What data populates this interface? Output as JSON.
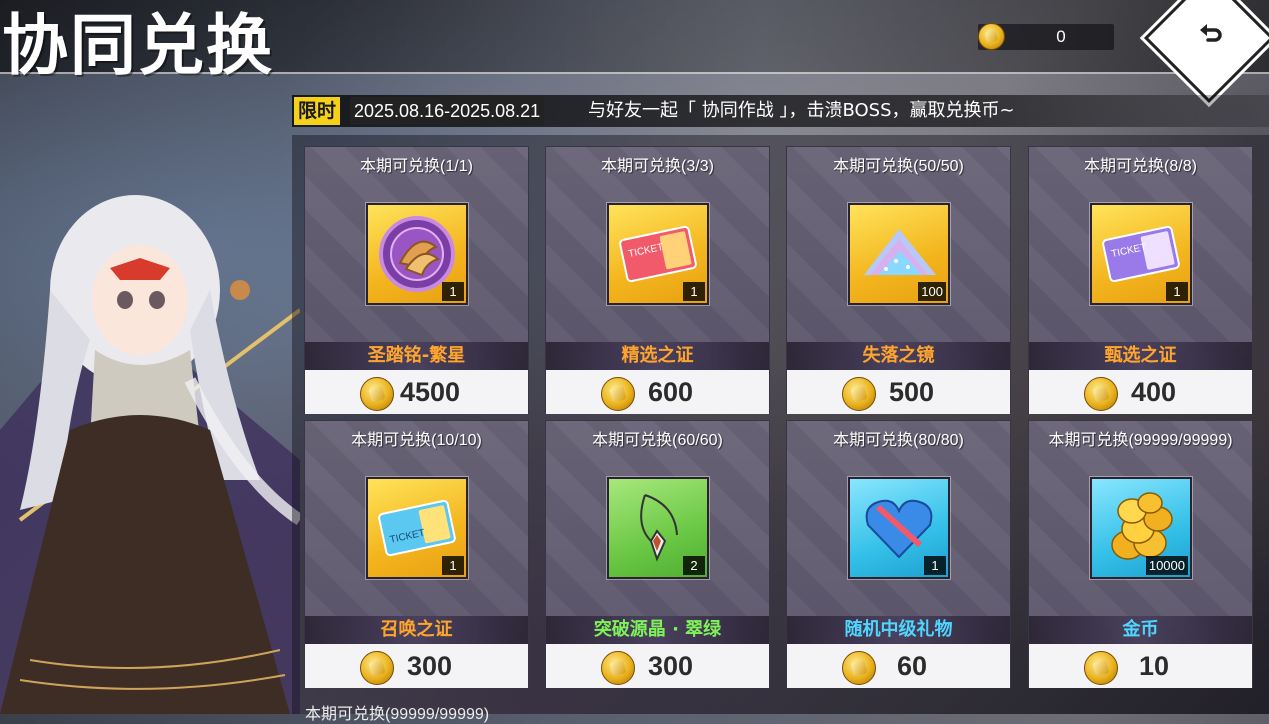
{
  "header": {
    "title": "协同兑换",
    "currency_value": "0",
    "back_icon": "undo-arrow-icon"
  },
  "banner": {
    "tag": "限时",
    "dates": "2025.08.16-2025.08.21",
    "description": "与好友一起「 协同作战 」，击溃BOSS，赢取兑换币~"
  },
  "items": [
    {
      "limit": "本期可兑换(1/1)",
      "name": "圣踏铭-繁星",
      "qty": "1",
      "price": "4500",
      "frame": "gold",
      "name_color": "orange",
      "icon": "star-emblem-icon"
    },
    {
      "limit": "本期可兑换(3/3)",
      "name": "精选之证",
      "qty": "1",
      "price": "600",
      "frame": "gold",
      "name_color": "orange",
      "icon": "ticket-icon"
    },
    {
      "limit": "本期可兑换(50/50)",
      "name": "失落之镜",
      "qty": "100",
      "price": "500",
      "frame": "gold",
      "name_color": "orange",
      "icon": "crystal-dust-icon"
    },
    {
      "limit": "本期可兑换(8/8)",
      "name": "甄选之证",
      "qty": "1",
      "price": "400",
      "frame": "gold",
      "name_color": "orange",
      "icon": "ticket-icon"
    },
    {
      "limit": "本期可兑换(10/10)",
      "name": "召唤之证",
      "qty": "1",
      "price": "300",
      "frame": "gold",
      "name_color": "orange",
      "icon": "ticket-icon"
    },
    {
      "limit": "本期可兑换(60/60)",
      "name": "突破源晶 · 翠绿",
      "qty": "2",
      "price": "300",
      "frame": "green",
      "name_color": "green",
      "icon": "crystal-pendant-icon"
    },
    {
      "limit": "本期可兑换(80/80)",
      "name": "随机中级礼物",
      "qty": "1",
      "price": "60",
      "frame": "blue",
      "name_color": "cyan",
      "icon": "heart-gift-box-icon"
    },
    {
      "limit": "本期可兑换(99999/99999)",
      "name": "金币",
      "qty": "10000",
      "price": "10",
      "frame": "blue",
      "name_color": "cyan",
      "icon": "gold-coins-icon"
    }
  ],
  "partial_row_text": "本期可兑换(99999/99999)"
}
